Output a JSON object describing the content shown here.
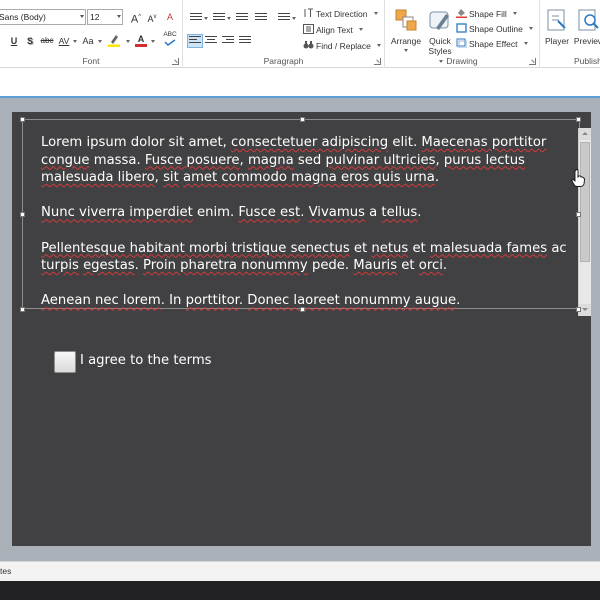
{
  "ribbon": {
    "font": {
      "label": "Font",
      "font_name": "Sans (Body)",
      "font_size": "12",
      "grow_glyph": "A",
      "shrink_glyph": "A",
      "clear_format_glyph": "A",
      "underline_glyph": "U",
      "shadow_glyph": "S",
      "strike_glyph": "abc",
      "spacing_glyph": "AV",
      "case_glyph": "Aa",
      "font_color_glyph": "A",
      "spell_glyph": "ABC",
      "highlight_color": "#ffe600",
      "font_color": "#d32f2f"
    },
    "paragraph": {
      "label": "Paragraph",
      "text_direction": "Text Direction",
      "align_text": "Align Text",
      "find_replace": "Find / Replace"
    },
    "drawing": {
      "label": "Drawing",
      "arrange": "Arrange",
      "quick_styles_line1": "Quick",
      "quick_styles_line2": "Styles",
      "shape_fill": "Shape Fill",
      "shape_outline": "Shape Outline",
      "shape_effect": "Shape Effect",
      "shape_fill_color": "#e03c31"
    },
    "publish": {
      "label": "Publish",
      "player": "Player",
      "preview": "Preview"
    }
  },
  "slide": {
    "background": "#414042",
    "paragraphs": [
      [
        {
          "t": "Lorem ipsum dolor sit amet, ",
          "s": false
        },
        {
          "t": "consectetuer adipiscing",
          "s": true
        },
        {
          "t": " elit. ",
          "s": false
        },
        {
          "t": "Maecenas porttitor congue",
          "s": true
        },
        {
          "t": " massa. ",
          "s": false
        },
        {
          "t": "Fusce posuere",
          "s": true
        },
        {
          "t": ", ",
          "s": false
        },
        {
          "t": "magna",
          "s": true
        },
        {
          "t": " sed ",
          "s": false
        },
        {
          "t": "pulvinar ultricies",
          "s": true
        },
        {
          "t": ", ",
          "s": false
        },
        {
          "t": "purus lectus malesuada libero",
          "s": true
        },
        {
          "t": ", ",
          "s": false
        },
        {
          "t": "sit",
          "s": true
        },
        {
          "t": " ",
          "s": false
        },
        {
          "t": "amet commodo magna eros quis urna",
          "s": true
        },
        {
          "t": ".",
          "s": false
        }
      ],
      [
        {
          "t": "Nunc viverra imperdiet",
          "s": true
        },
        {
          "t": " enim. ",
          "s": false
        },
        {
          "t": "Fusce est",
          "s": true
        },
        {
          "t": ". ",
          "s": false
        },
        {
          "t": "Vivamus",
          "s": true
        },
        {
          "t": " a ",
          "s": false
        },
        {
          "t": "tellus",
          "s": true
        },
        {
          "t": ".",
          "s": false
        }
      ],
      [
        {
          "t": "Pellentesque habitant morbi tristique senectus",
          "s": true
        },
        {
          "t": " et ",
          "s": false
        },
        {
          "t": "netus",
          "s": true
        },
        {
          "t": " et ",
          "s": false
        },
        {
          "t": "malesuada fames",
          "s": true
        },
        {
          "t": " ac ",
          "s": false
        },
        {
          "t": "turpis",
          "s": true
        },
        {
          "t": " ",
          "s": false
        },
        {
          "t": "egestas",
          "s": true
        },
        {
          "t": ". ",
          "s": false
        },
        {
          "t": "Proin pharetra nonummy",
          "s": true
        },
        {
          "t": " pede. ",
          "s": false
        },
        {
          "t": "Mauris",
          "s": true
        },
        {
          "t": " et ",
          "s": false
        },
        {
          "t": "orci",
          "s": true
        },
        {
          "t": ".",
          "s": false
        }
      ],
      [
        {
          "t": "Aenean nec lorem",
          "s": true
        },
        {
          "t": ". In ",
          "s": false
        },
        {
          "t": "porttitor",
          "s": true
        },
        {
          "t": ". ",
          "s": false
        },
        {
          "t": "Donec laoreet nonummy augue",
          "s": true
        },
        {
          "t": ".",
          "s": false
        }
      ]
    ],
    "checkbox_label": "I agree to the terms",
    "checkbox_checked": false
  },
  "status": {
    "notes_text": "tes"
  }
}
